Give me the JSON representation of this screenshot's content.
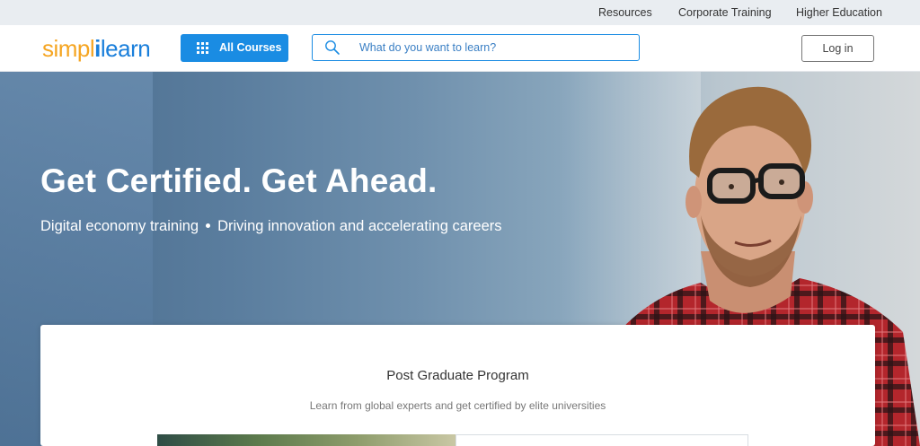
{
  "topbar": {
    "links": [
      "Resources",
      "Corporate Training",
      "Higher Education"
    ]
  },
  "header": {
    "logo": {
      "part1": "simpl",
      "bar": "i",
      "part2": "learn"
    },
    "all_courses_label": "All Courses",
    "search_placeholder": "What do you want to learn?",
    "login_label": "Log in"
  },
  "hero": {
    "title": "Get Certified. Get Ahead.",
    "subtitle_left": "Digital economy training",
    "subtitle_right": "Driving innovation and accelerating careers"
  },
  "card": {
    "title": "Post Graduate Program",
    "subtitle": "Learn from global experts and get certified by elite universities"
  },
  "colors": {
    "brand_blue": "#1a8ce3",
    "brand_orange": "#f5a522"
  }
}
